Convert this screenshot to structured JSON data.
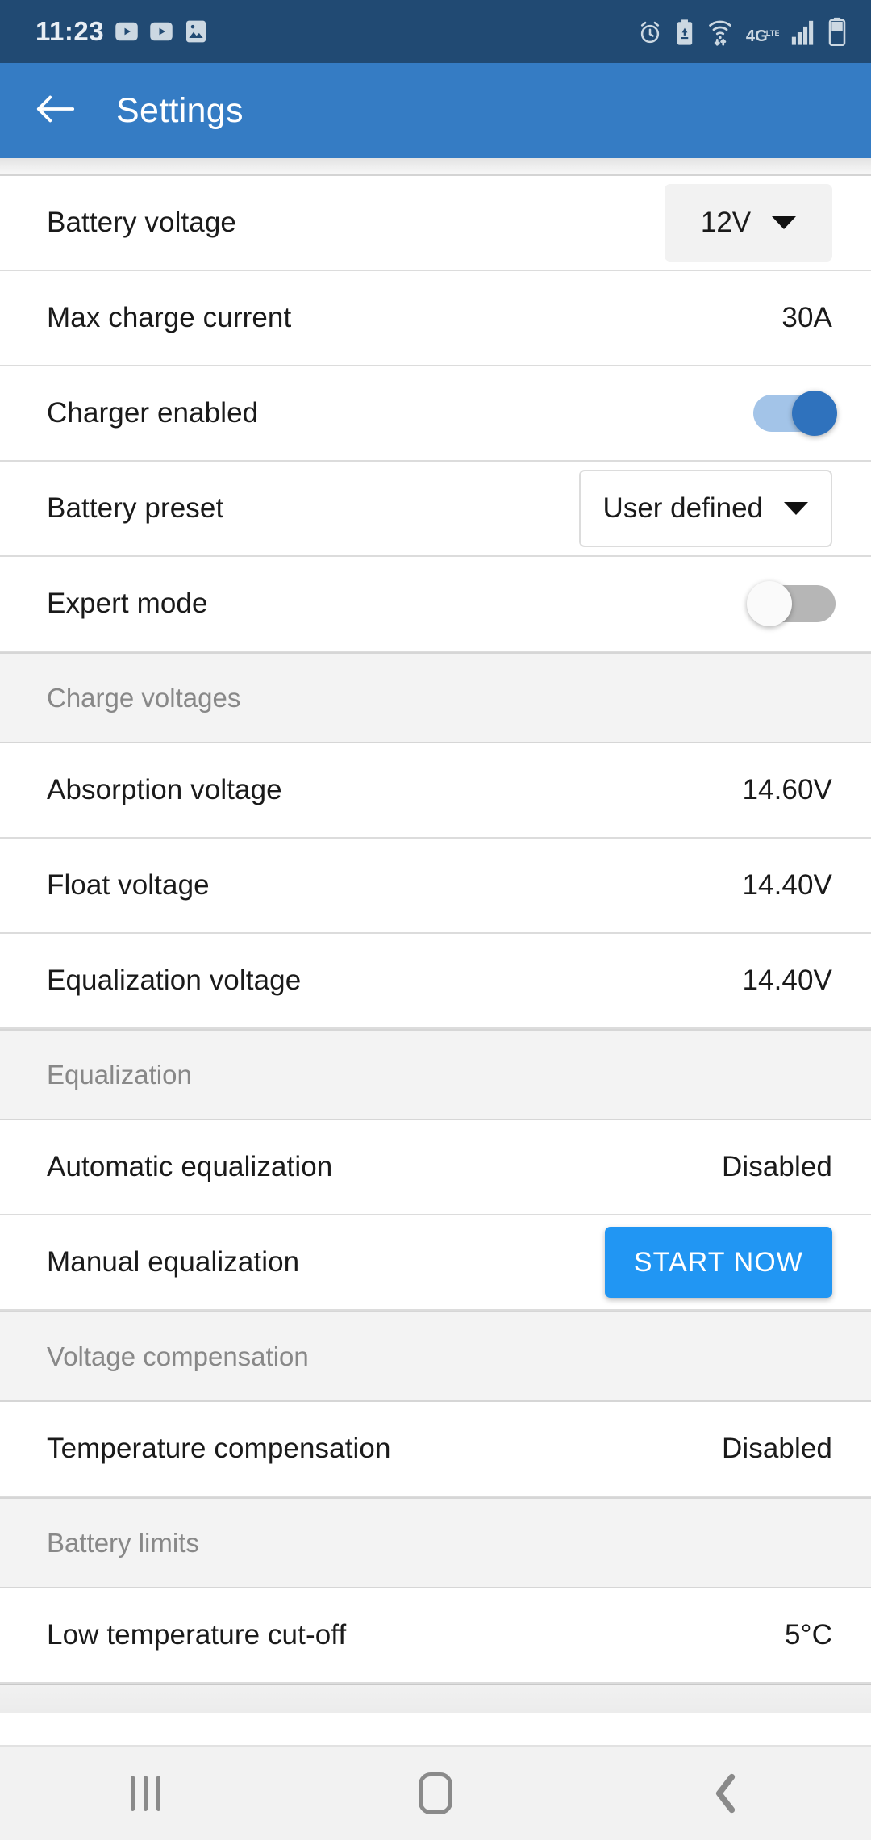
{
  "status_bar": {
    "time": "11:23",
    "left_icons": [
      "play-store-icon",
      "youtube-icon",
      "photo-icon"
    ],
    "right_icons": [
      "alarm-icon",
      "battery-saver-icon",
      "wifi-data-icon",
      "network-4g-lte-icon",
      "signal-bars-icon",
      "battery-icon"
    ],
    "network_label": "4G",
    "network_sub": "LTE",
    "bg_color": "#214a73"
  },
  "app_bar": {
    "title": "Settings",
    "back_icon": "arrow-left-icon",
    "bg_color": "#357cc4"
  },
  "sections": [
    {
      "id": "general",
      "header": null,
      "rows": [
        {
          "id": "battery-voltage",
          "label": "Battery voltage",
          "control": "dropdown-filled",
          "value": "12V"
        },
        {
          "id": "max-charge-current",
          "label": "Max charge current",
          "control": "text",
          "value": "30A"
        },
        {
          "id": "charger-enabled",
          "label": "Charger enabled",
          "control": "toggle-on",
          "value": "On"
        },
        {
          "id": "battery-preset",
          "label": "Battery preset",
          "control": "dropdown-outline",
          "value": "User defined"
        },
        {
          "id": "expert-mode",
          "label": "Expert mode",
          "control": "toggle-off",
          "value": "Off"
        }
      ]
    },
    {
      "id": "charge-voltages",
      "header": "Charge voltages",
      "rows": [
        {
          "id": "absorption-voltage",
          "label": "Absorption voltage",
          "control": "text",
          "value": "14.60V"
        },
        {
          "id": "float-voltage",
          "label": "Float voltage",
          "control": "text",
          "value": "14.40V"
        },
        {
          "id": "equalization-voltage",
          "label": "Equalization voltage",
          "control": "text",
          "value": "14.40V"
        }
      ]
    },
    {
      "id": "equalization",
      "header": "Equalization",
      "rows": [
        {
          "id": "automatic-equalization",
          "label": "Automatic equalization",
          "control": "text",
          "value": "Disabled"
        },
        {
          "id": "manual-equalization",
          "label": "Manual equalization",
          "control": "button",
          "value": "START NOW"
        }
      ]
    },
    {
      "id": "voltage-compensation",
      "header": "Voltage compensation",
      "rows": [
        {
          "id": "temperature-compensation",
          "label": "Temperature compensation",
          "control": "text",
          "value": "Disabled"
        }
      ]
    },
    {
      "id": "battery-limits",
      "header": "Battery limits",
      "rows": [
        {
          "id": "low-temperature-cut-off",
          "label": "Low temperature cut-off",
          "control": "text",
          "value": "5°C"
        }
      ]
    }
  ],
  "nav_bar": {
    "recents_icon": "recents-icon",
    "home_icon": "home-icon",
    "back_icon": "back-chevron-icon",
    "bg_color": "#f2f2f2"
  },
  "colors": {
    "accent": "#2196f3",
    "app_bar": "#357cc4",
    "status_bar": "#214a73",
    "section_header_bg": "#f3f3f3",
    "toggle_on_thumb": "#2f72bd",
    "toggle_on_track": "#a3c4e8",
    "toggle_off_track": "#b6b6b6"
  }
}
